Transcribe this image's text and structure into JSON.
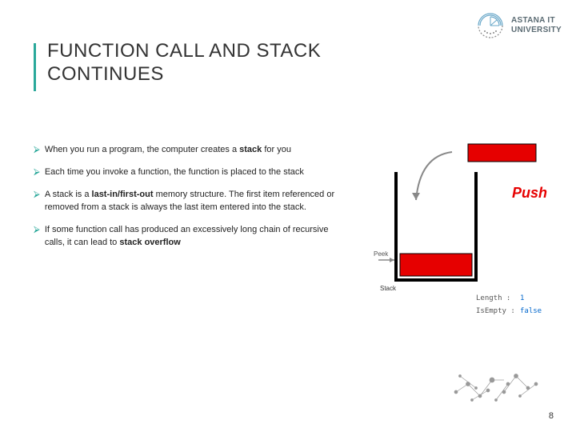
{
  "logo": {
    "line1": "ASTANA IT",
    "line2": "UNIVERSITY"
  },
  "title": "FUNCTION CALL AND STACK CONTINUES",
  "bullets": [
    {
      "pre": "When you run a program, the computer creates a ",
      "bold": "stack",
      "post": " for you"
    },
    {
      "pre": "Each time you invoke a function, the function is placed to the stack",
      "bold": "",
      "post": ""
    },
    {
      "pre": "A stack is a ",
      "bold": "last-in/first-out",
      "post": " memory structure. The first item referenced or removed from a stack is always the last item entered into the stack."
    },
    {
      "pre": "If some function call has produced an excessively long chain of recursive calls, it can lead to ",
      "bold": "stack overflow",
      "post": ""
    }
  ],
  "diagram": {
    "push_label": "Push",
    "peek_label": "Peek",
    "stack_label": "Stack",
    "length_label": "Length :",
    "length_value": "1",
    "isempty_label": "IsEmpty :",
    "isempty_value": "false"
  },
  "page_number": "8"
}
